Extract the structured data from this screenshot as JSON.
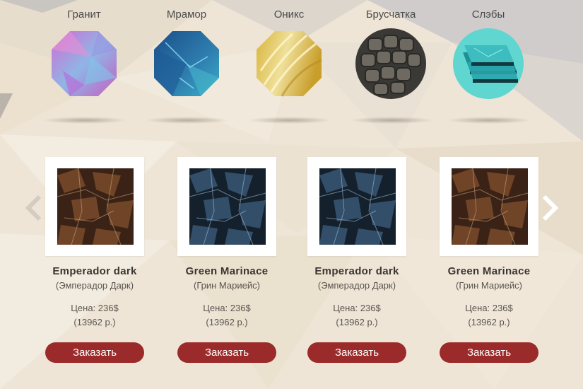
{
  "categories": [
    {
      "label": "Гранит",
      "icon": "granite-stone-icon"
    },
    {
      "label": "Мрамор",
      "icon": "marble-stone-icon"
    },
    {
      "label": "Оникс",
      "icon": "onyx-stone-icon"
    },
    {
      "label": "Брусчатка",
      "icon": "paving-stone-icon"
    },
    {
      "label": "Слэбы",
      "icon": "slabs-icon"
    }
  ],
  "products": [
    {
      "name": "Emperador dark",
      "subtitle": "(Эмперадор Дарк)",
      "price": "Цена: 236$",
      "price_rub": "(13962 р.)",
      "button": "Заказать",
      "texture": "brown"
    },
    {
      "name": "Green Marinace",
      "subtitle": "(Грин Мариейс)",
      "price": "Цена: 236$",
      "price_rub": "(13962 р.)",
      "button": "Заказать",
      "texture": "blue"
    },
    {
      "name": "Emperador dark",
      "subtitle": "(Эмперадор Дарк)",
      "price": "Цена: 236$",
      "price_rub": "(13962 р.)",
      "button": "Заказать",
      "texture": "blue"
    },
    {
      "name": "Green Marinace",
      "subtitle": "(Грин Мариейс)",
      "price": "Цена: 236$",
      "price_rub": "(13962 р.)",
      "button": "Заказать",
      "texture": "brown"
    }
  ],
  "nav": {
    "prev_icon": "chevron-left-icon",
    "next_icon": "chevron-right-icon"
  },
  "colors": {
    "button": "#9b2a2a",
    "background": "#efe6d8"
  }
}
